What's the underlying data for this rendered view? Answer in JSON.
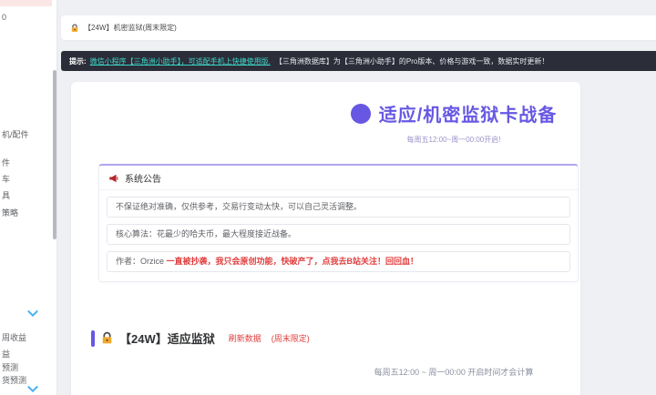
{
  "colors": {
    "accent_purple": "#6758e3",
    "notice_bg": "#2b2d39",
    "notice_link_teal": "#3ed6c5",
    "alert_red": "#e03e3e",
    "sidebar_selected_pink": "#fbe6e6",
    "page_bg": "#eef0f4"
  },
  "sidebar": {
    "fragments": [
      "0",
      "机/配件",
      "件",
      "车",
      "具",
      "策略",
      "周收益",
      "益",
      "预测",
      "货预测"
    ]
  },
  "topbar": {
    "title": "【24W】机密监狱(周末限定)"
  },
  "notice": {
    "prefix": "提示:",
    "link": "微信小程序【三角洲小助手】，可适配手机上快捷使用版.",
    "rest": "【三角洲数据库】为【三角洲小助手】的Pro版本、价格与游戏一致，数据实时更新！"
  },
  "hero": {
    "title": "适应/机密监狱卡战备",
    "subtitle": "每周五12:00~周一00:00开启!"
  },
  "announcement": {
    "title": "系统公告",
    "rows": [
      "不保证绝对准确，仅供参考，交易行变动太快，可以自己灵活调整。",
      "核心算法：花最少的哈夫币，最大程度接近战备。"
    ],
    "author_prefix": "作者：Orzice ",
    "author_link": "一直被抄袭，我只会原创功能，快破产了，点我去B站关注！回回血！"
  },
  "section": {
    "title": "【24W】适应监狱",
    "refresh_label": "刷新数据",
    "limited_label": "(周末限定)",
    "schedule_note": "每周五12:00 ~ 周一00:00 开启时间才会计算"
  }
}
